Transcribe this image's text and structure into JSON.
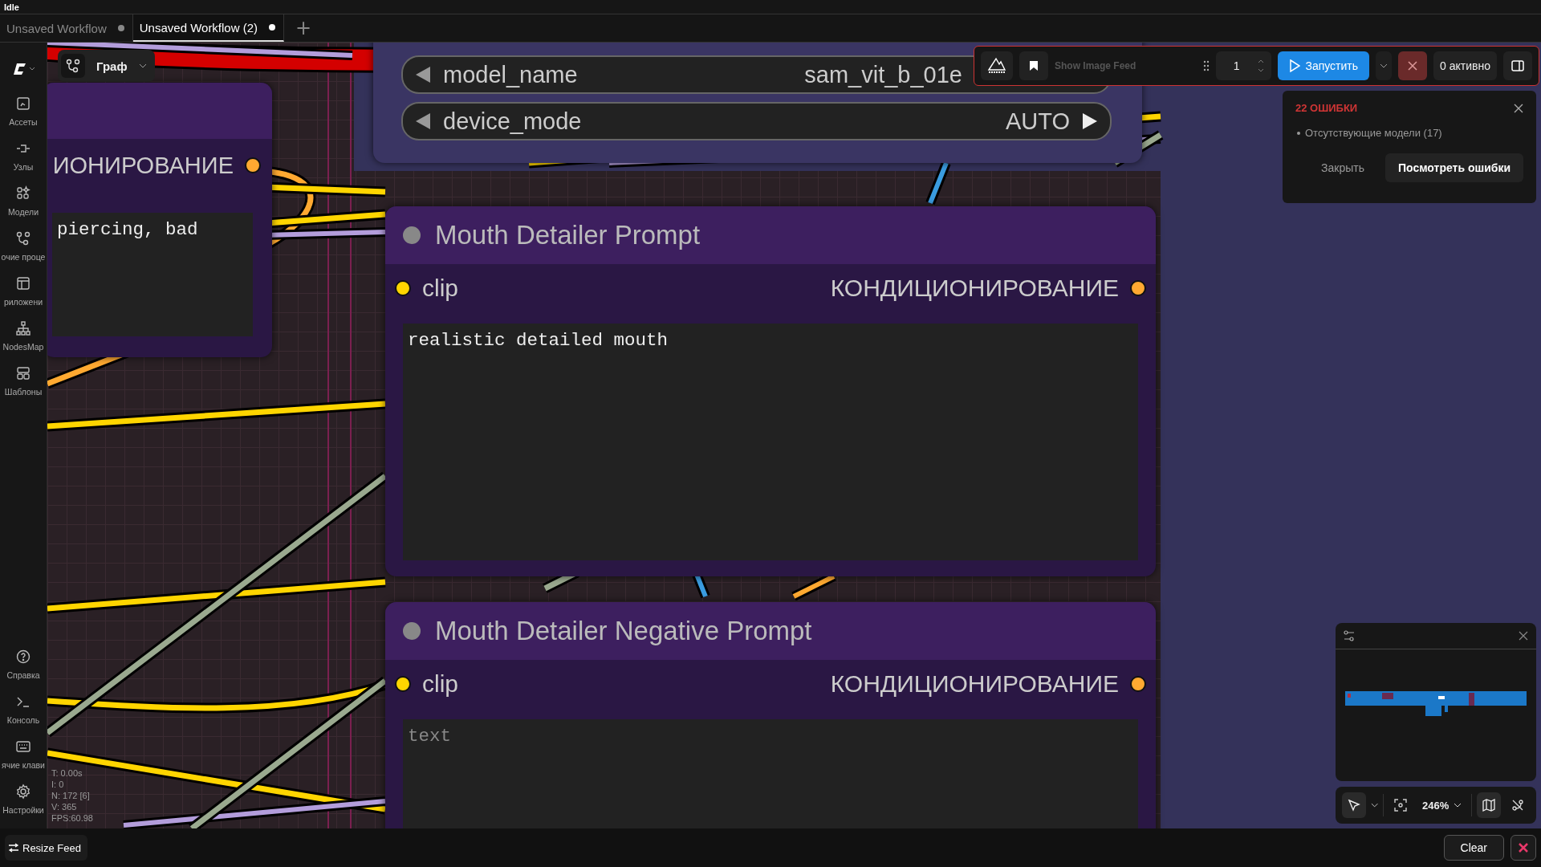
{
  "status": "Idle",
  "tabs": [
    {
      "label": "Unsaved Workflow",
      "selected": false
    },
    {
      "label": "Unsaved Workflow (2)",
      "selected": true
    }
  ],
  "new_tab": "+",
  "sidebar": {
    "top": [
      {
        "label": "Ассеты"
      },
      {
        "label": "Узлы"
      },
      {
        "label": "Модели"
      },
      {
        "label": "очие проце"
      },
      {
        "label": "риложени"
      },
      {
        "label": "NodesMap"
      },
      {
        "label": "Шаблоны"
      }
    ],
    "bottom": [
      {
        "label": "Справка"
      },
      {
        "label": "Консоль"
      },
      {
        "label": "ячие клави"
      },
      {
        "label": "Настройки"
      }
    ]
  },
  "graph_button": {
    "label": "Граф"
  },
  "nodes": [
    {
      "kind": "widgets",
      "widgets": [
        {
          "name": "model_name",
          "value": "sam_vit_b_01e"
        },
        {
          "name": "device_mode",
          "value": "AUTO"
        }
      ]
    },
    {
      "kind": "partial",
      "output": "ИОНИРОВАНИЕ",
      "text": "piercing, bad"
    },
    {
      "kind": "prompt",
      "title": "Mouth Detailer Prompt",
      "input": "clip",
      "output": "КОНДИЦИОНИРОВАНИЕ",
      "text": "realistic detailed mouth"
    },
    {
      "kind": "prompt",
      "title": "Mouth Detailer Negative Prompt",
      "input": "clip",
      "output": "КОНДИЦИОНИРОВАНИЕ",
      "placeholder": "text"
    }
  ],
  "toolbar": {
    "show_image_feed": "Show Image Feed",
    "batch_count": "1",
    "run": "Запустить",
    "active": "0 активно"
  },
  "errors": {
    "title": "22 ОШИБКИ",
    "items": [
      "Отсутствующие модели (17)"
    ],
    "dismiss": "Закрыть",
    "view": "Посмотреть ошибки"
  },
  "stats": [
    "T: 0.00s",
    "I: 0",
    "N: 172 [6]",
    "V: 365",
    "FPS:60.98"
  ],
  "zoom": "246%",
  "bottom_bar": {
    "resize": "Resize Feed",
    "clear": "Clear"
  }
}
